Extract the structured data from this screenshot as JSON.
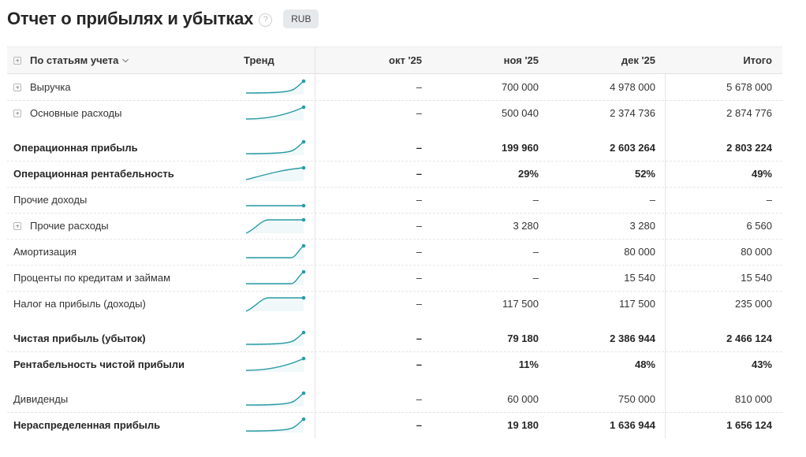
{
  "header": {
    "title": "Отчет о прибылях и убытках",
    "help_icon": "?",
    "currency": "RUB"
  },
  "columns": {
    "label": "По статьям учета",
    "trend": "Тренд",
    "oct": "окт '25",
    "nov": "ноя '25",
    "dec": "дек '25",
    "total": "Итого"
  },
  "colors": {
    "spark": "#2a9ba3"
  },
  "rows": [
    {
      "label": "Выручка",
      "oct": "–",
      "nov": "700 000",
      "dec": "4 978 000",
      "total": "5 678 000",
      "bold": false,
      "expand": true,
      "trend": "exp",
      "gap_after": false
    },
    {
      "label": "Основные расходы",
      "oct": "–",
      "nov": "500 040",
      "dec": "2 374 736",
      "total": "2 874 776",
      "bold": false,
      "expand": true,
      "trend": "curve",
      "gap_after": true
    },
    {
      "label": "Операционная прибыль",
      "oct": "–",
      "nov": "199 960",
      "dec": "2 603 264",
      "total": "2 803 224",
      "bold": true,
      "expand": false,
      "trend": "exp",
      "gap_after": false
    },
    {
      "label": "Операционная рентабельность",
      "oct": "–",
      "nov": "29%",
      "dec": "52%",
      "total": "49%",
      "bold": true,
      "expand": false,
      "trend": "linear",
      "gap_after": false
    },
    {
      "label": "Прочие доходы",
      "oct": "–",
      "nov": "–",
      "dec": "–",
      "total": "–",
      "bold": false,
      "expand": false,
      "trend": "flat",
      "gap_after": false
    },
    {
      "label": "Прочие расходы",
      "oct": "–",
      "nov": "3 280",
      "dec": "3 280",
      "total": "6 560",
      "bold": false,
      "expand": true,
      "trend": "step",
      "gap_after": false
    },
    {
      "label": "Амортизация",
      "oct": "–",
      "nov": "–",
      "dec": "80 000",
      "total": "80 000",
      "bold": false,
      "expand": false,
      "trend": "late",
      "gap_after": false
    },
    {
      "label": "Проценты по кредитам и займам",
      "oct": "–",
      "nov": "–",
      "dec": "15 540",
      "total": "15 540",
      "bold": false,
      "expand": false,
      "trend": "late",
      "gap_after": false
    },
    {
      "label": "Налог на прибыль (доходы)",
      "oct": "–",
      "nov": "117 500",
      "dec": "117 500",
      "total": "235 000",
      "bold": false,
      "expand": false,
      "trend": "step",
      "gap_after": true
    },
    {
      "label": "Чистая прибыль (убыток)",
      "oct": "–",
      "nov": "79 180",
      "dec": "2 386 944",
      "total": "2 466 124",
      "bold": true,
      "expand": false,
      "trend": "exp",
      "gap_after": false
    },
    {
      "label": "Рентабельность чистой прибыли",
      "oct": "–",
      "nov": "11%",
      "dec": "48%",
      "total": "43%",
      "bold": true,
      "expand": false,
      "trend": "curve",
      "gap_after": true
    },
    {
      "label": "Дивиденды",
      "oct": "–",
      "nov": "60 000",
      "dec": "750 000",
      "total": "810 000",
      "bold": false,
      "expand": false,
      "trend": "exp",
      "gap_after": false
    },
    {
      "label": "Нераспределенная прибыль",
      "oct": "–",
      "nov": "19 180",
      "dec": "1 636 944",
      "total": "1 656 124",
      "bold": true,
      "expand": false,
      "trend": "exp",
      "gap_after": false
    }
  ]
}
